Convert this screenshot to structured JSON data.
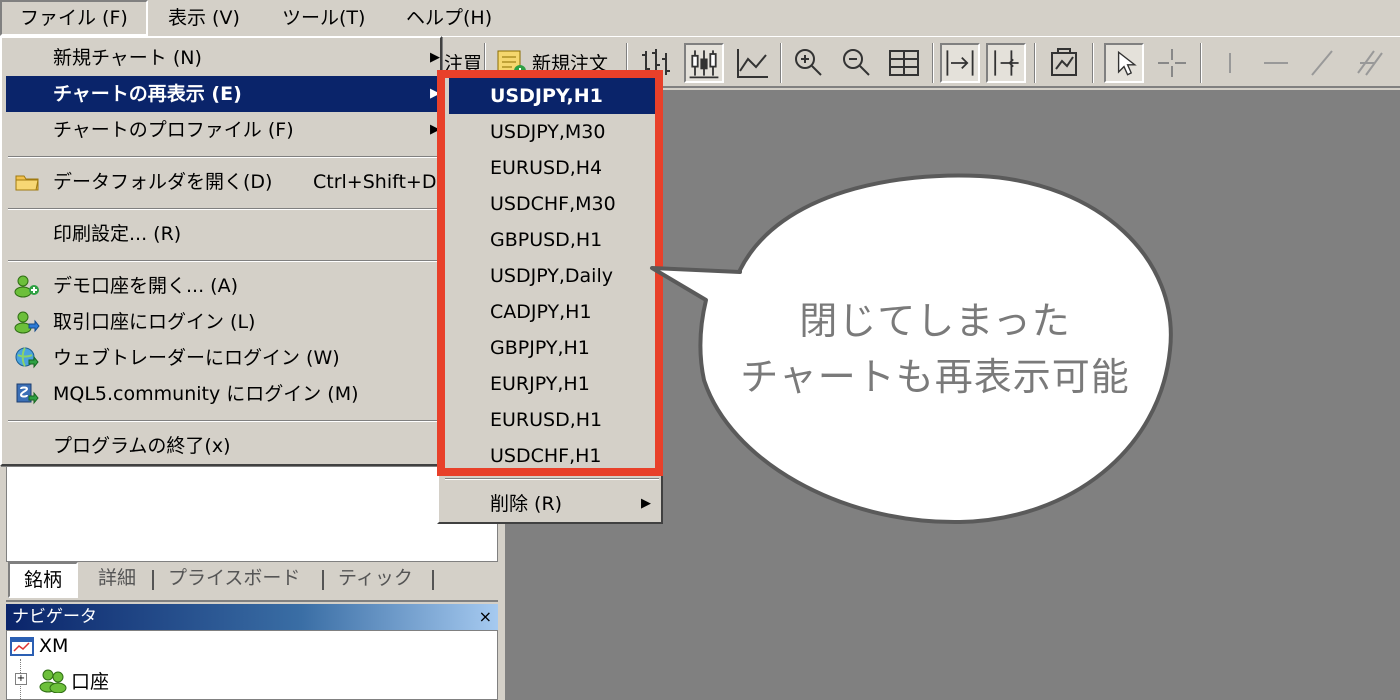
{
  "menubar": {
    "file": "ファイル (F)",
    "view": "表示 (V)",
    "tools": "ツール(T)",
    "help": "ヘルプ(H)"
  },
  "toolbar": {
    "partial_label": "注買",
    "new_order": "新規注文"
  },
  "file_menu": {
    "items": [
      {
        "label": "新規チャート (N)",
        "submenu": true
      },
      {
        "label": "チャートの再表示 (E)",
        "submenu": true,
        "highlighted": true
      },
      {
        "label": "チャートのプロファイル (F)",
        "submenu": true
      },
      {
        "label": "データフォルダを開く(D)",
        "shortcut": "Ctrl+Shift+D",
        "icon": "folder-icon"
      },
      {
        "label": "印刷設定... (R)"
      },
      {
        "label": "デモ口座を開く... (A)",
        "icon": "demo-account-icon"
      },
      {
        "label": "取引口座にログイン (L)",
        "icon": "trade-login-icon"
      },
      {
        "label": "ウェブトレーダーにログイン (W)",
        "icon": "web-trader-icon"
      },
      {
        "label": "MQL5.community にログイン (M)",
        "icon": "mql5-icon"
      },
      {
        "label": "プログラムの終了(x)"
      }
    ]
  },
  "reopen_submenu": {
    "items": [
      "USDJPY,H1",
      "USDJPY,M30",
      "EURUSD,H4",
      "USDCHF,M30",
      "GBPUSD,H1",
      "USDJPY,Daily",
      "CADJPY,H1",
      "GBPJPY,H1",
      "EURJPY,H1",
      "EURUSD,H1",
      "USDCHF,H1"
    ],
    "delete": "削除 (R)"
  },
  "market_tabs": [
    "銘柄",
    "詳細",
    "プライスボード",
    "ティック"
  ],
  "navigator": {
    "title": "ナビゲータ",
    "close": "×",
    "root": "XM",
    "accounts": "口座"
  },
  "callout": {
    "line1": "閉じてしまった",
    "line2": "チャートも再表示可能"
  },
  "colors": {
    "highlight": "#0a246a",
    "red_box": "#e8402a",
    "workspace": "#808080"
  }
}
